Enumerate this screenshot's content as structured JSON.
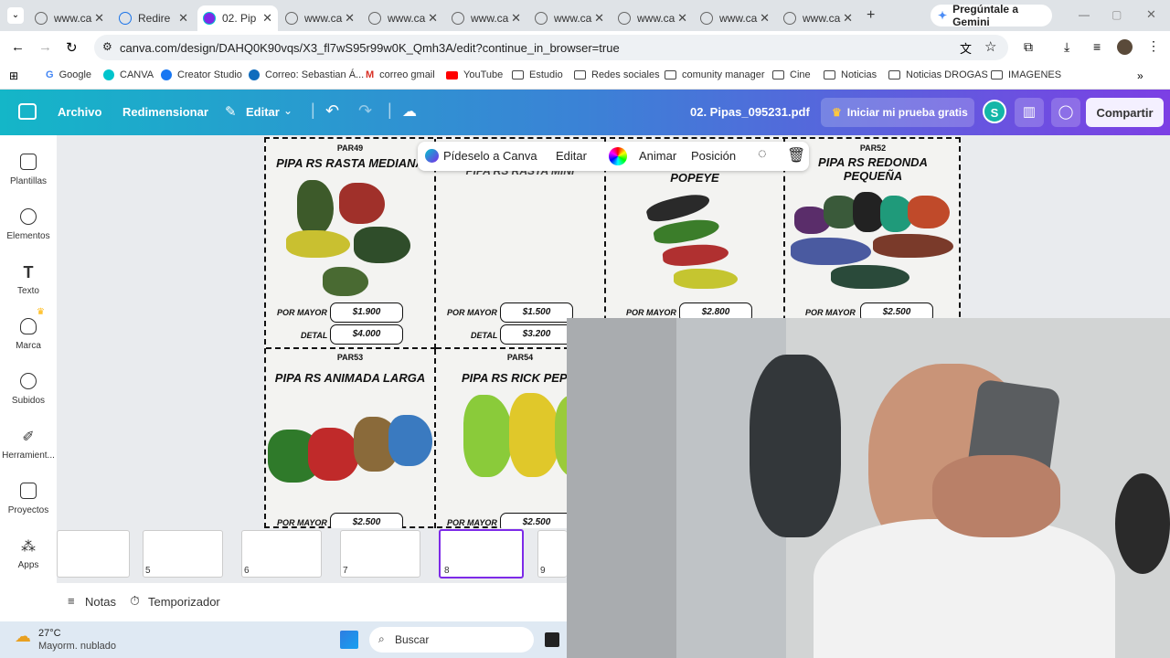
{
  "browser": {
    "tabs": [
      {
        "label": "www.ca"
      },
      {
        "label": "Redire"
      },
      {
        "label": "02. Pip"
      },
      {
        "label": "www.ca"
      },
      {
        "label": "www.ca"
      },
      {
        "label": "www.ca"
      },
      {
        "label": "www.ca"
      },
      {
        "label": "www.ca"
      },
      {
        "label": "www.ca"
      },
      {
        "label": "www.ca"
      }
    ],
    "gemini_label": "Pregúntale a Gemini",
    "url": "canva.com/design/DAHQ0K90vqs/X3_fl7wS95r99w0K_Qmh3A/edit?continue_in_browser=true",
    "bookmarks": [
      "Google",
      "CANVA",
      "Creator Studio",
      "Correo: Sebastian Á...",
      "correo gmail",
      "YouTube",
      "Estudio",
      "Redes sociales",
      "comunity manager",
      "Cine",
      "Noticias",
      "Noticias DROGAS",
      "IMAGENES"
    ]
  },
  "canva_header": {
    "archivo": "Archivo",
    "redimensionar": "Redimensionar",
    "editar": "Editar",
    "doc_title": "02. Pipas_095231.pdf",
    "trial": "Iniciar mi prueba gratis",
    "avatar": "S",
    "share": "Compartir"
  },
  "sidebar": [
    "Plantillas",
    "Elementos",
    "Texto",
    "Marca",
    "Subidos",
    "Herramient...",
    "Proyectos",
    "Apps"
  ],
  "floating_toolbar": {
    "ask": "Pídeselo a Canva",
    "edit": "Editar",
    "animate": "Animar",
    "position": "Posición"
  },
  "products": [
    {
      "code": "PAR49",
      "title": "PIPA RS RASTA MEDIANA",
      "mayor_label": "POR MAYOR",
      "mayor": "$1.900",
      "detal_label": "DETAL",
      "detal": "$4.000"
    },
    {
      "code": "",
      "title": "PIPA RS RASTA MINI",
      "mayor_label": "POR MAYOR",
      "mayor": "$1.500",
      "detal_label": "DETAL",
      "detal": "$3.200"
    },
    {
      "code": "",
      "title": "POPEYE",
      "mayor_label": "POR MAYOR",
      "mayor": "$2.800"
    },
    {
      "code": "PAR52",
      "title": "PIPA RS REDONDA PEQUEÑA",
      "mayor_label": "POR MAYOR",
      "mayor": "$2.500"
    },
    {
      "code": "PAR53",
      "title": "PIPA RS ANIMADA LARGA",
      "mayor_label": "POR MAYOR",
      "mayor": "$2.500"
    },
    {
      "code": "PAR54",
      "title": "PIPA RS RICK PEPIN",
      "mayor_label": "POR MAYOR",
      "mayor": "$2.500"
    }
  ],
  "thumbnails": [
    "5",
    "6",
    "7",
    "8",
    "9"
  ],
  "notes": {
    "notes": "Notas",
    "timer": "Temporizador"
  },
  "taskbar": {
    "temp": "27°C",
    "weather": "Mayorm. nublado",
    "search": "Buscar"
  }
}
